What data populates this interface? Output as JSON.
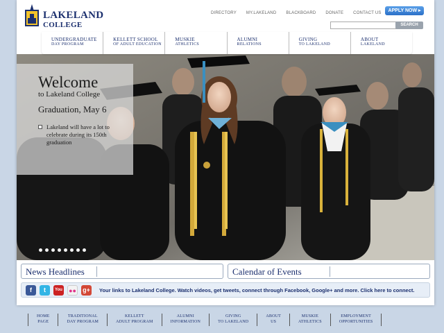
{
  "college": {
    "name": "LAKELAND",
    "sub": "COLLEGE"
  },
  "utility_links": [
    "DIRECTORY",
    "MY.LAKELAND",
    "BLACKBOARD",
    "DONATE",
    "CONTACT US"
  ],
  "apply_label": "APPLY NOW ▸",
  "search": {
    "button": "SEARCH",
    "value": ""
  },
  "nav": [
    {
      "l1": "UNDERGRADUATE",
      "l2": "DAY PROGRAM"
    },
    {
      "l1": "KELLETT SCHOOL",
      "l2": "OF ADULT EDUCATION"
    },
    {
      "l1": "MUSKIE",
      "l2": "ATHLETICS"
    },
    {
      "l1": "ALUMNI",
      "l2": "RELATIONS"
    },
    {
      "l1": "GIVING",
      "l2": "TO LAKELAND"
    },
    {
      "l1": "ABOUT",
      "l2": "LAKELAND"
    }
  ],
  "hero": {
    "title": "Welcome",
    "subtitle": "to Lakeland College",
    "headline": "Graduation, May 6",
    "text": "Lakeland will have a lot to celebrate during its 150th graduation",
    "slide_count": 8
  },
  "panels": {
    "news": "News Headlines",
    "calendar": "Calendar of Events"
  },
  "social": {
    "icons": [
      {
        "name": "facebook-icon",
        "glyph": "f",
        "color": "#3b5998"
      },
      {
        "name": "twitter-icon",
        "glyph": "t",
        "color": "#33b5e5"
      },
      {
        "name": "youtube-icon",
        "glyph": "You",
        "color": "#cc2222"
      },
      {
        "name": "flickr-icon",
        "glyph": "●●",
        "color": "#f3f3f3"
      },
      {
        "name": "google-plus-icon",
        "glyph": "g+",
        "color": "#d34836"
      }
    ],
    "text": "Your links to Lakeland College. Watch videos, get tweets, connect through Facebook, Google+ and more. Click here to connect."
  },
  "footer": [
    {
      "l1": "HOME",
      "l2": "PAGE"
    },
    {
      "l1": "TRADITIONAL",
      "l2": "DAY PROGRAM"
    },
    {
      "l1": "KELLETT",
      "l2": "ADULT PROGRAM"
    },
    {
      "l1": "ALUMNI",
      "l2": "INFORMATION"
    },
    {
      "l1": "GIVING",
      "l2": "TO LAKELAND"
    },
    {
      "l1": "ABOUT",
      "l2": "US"
    },
    {
      "l1": "MUSKIE",
      "l2": "ATHLETICS"
    },
    {
      "l1": "EMPLOYMENT",
      "l2": "OPPORTUNITIES"
    }
  ]
}
